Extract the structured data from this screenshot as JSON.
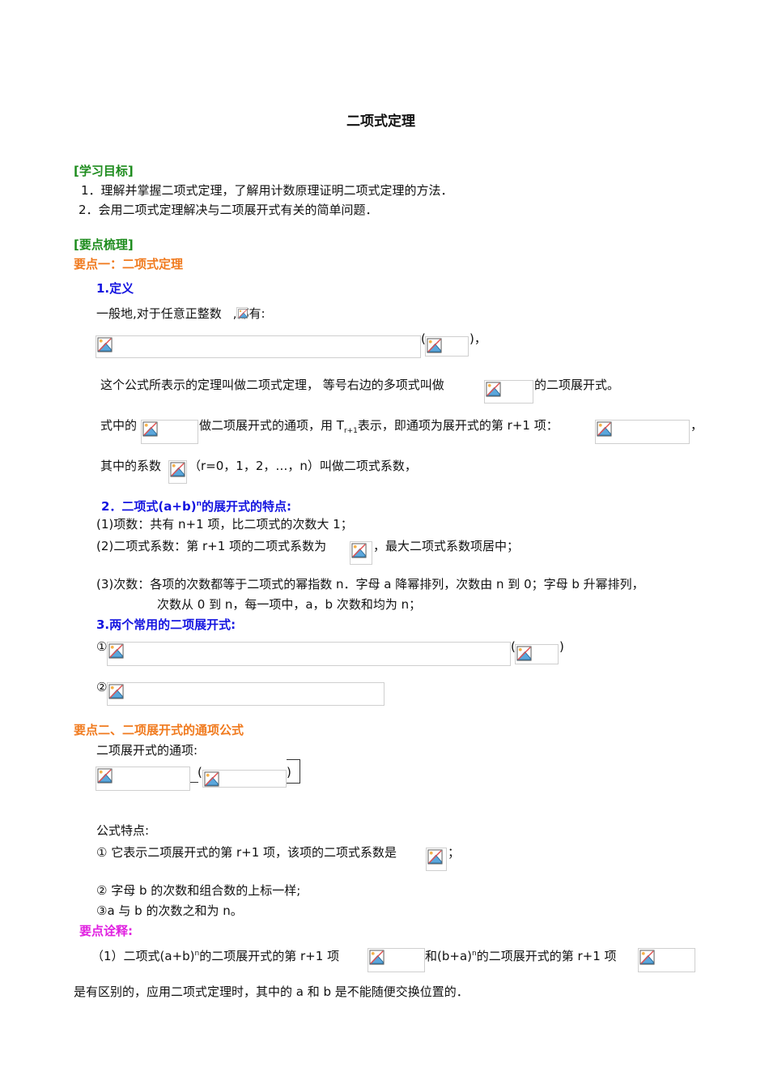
{
  "title": "二项式定理",
  "goals": {
    "heading": "[学习目标]",
    "items": [
      "1．理解并掌握二项式定理，了解用计数原理证明二项式定理的方法．",
      "2．会用二项式定理解决与二项展开式有关的简单问题．"
    ]
  },
  "points": {
    "heading": "[要点梳理]"
  },
  "sec1": {
    "heading": "要点一：二项式定理",
    "def_heading": "1.定义",
    "def_line": "一般地,对于任意正整数",
    "def_line_end": ",都有:",
    "paren_open": "(",
    "paren_close": ")，",
    "line2a": "这个公式所表示的定理叫做二项式定理， 等号右边的多项式叫做",
    "line2b": "的二项展开式。",
    "line3a": "式中的",
    "line3b": "做二项展开式的通项，用 T",
    "line3sub": "r+1",
    "line3c": "表示，即通项为展开式的第 r+1 项：",
    "line3end": "，",
    "line4a": "其中的系数",
    "line4b": "（r=0，1，2，…，n）叫做二项式系数，",
    "feat_heading_a": "2．二项式(a+b)",
    "feat_heading_sup": "n",
    "feat_heading_b": "的展开式的特点:",
    "feat1": "(1)项数：共有 n+1 项，比二项式的次数大 1；",
    "feat2a": "(2)二项式系数：第 r+1 项的二项式系数为",
    "feat2b": "，最大二项式系数项居中；",
    "feat3a": "(3)次数：各项的次数都等于二项式的幂指数 n．字母 a 降幂排列，次数由 n 到 0；字母 b 升幂排列，",
    "feat3b": "次数从 0 到 n，每一项中，a，b 次数和均为 n；",
    "common_heading": "3.两个常用的二项展开式:",
    "c1": "①",
    "c1_open": "(",
    "c1_close": ")",
    "c2": "②"
  },
  "sec2": {
    "heading": "要点二、二项展开式的通项公式",
    "general": "二项展开式的通项:",
    "paren_open": "(",
    "paren_close": ")",
    "feat_title": "公式特点:",
    "f1a": "① 它表示二项展开式的第 r+1 项，该项的二项式系数是",
    "f1b": "；",
    "f2": "② 字母 b 的次数和组合数的上标一样;",
    "f3": "③a 与 b 的次数之和为 n。",
    "note_heading": "要点诠释:",
    "n1a": "（1）二项式(a+b)",
    "n1sup": "n",
    "n1b": "的二项展开式的第 r+1 项",
    "n1c": "和(b+a)",
    "n1d": "的二项展开式的第 r+1 项",
    "n2": "是有区别的，应用二项式定理时，其中的 a 和 b 是不能随便交换位置的．"
  },
  "colors": {
    "green": "#1e8c1e",
    "orange": "#f07a1e",
    "blue": "#1414e0",
    "magenta": "#e020e0"
  }
}
